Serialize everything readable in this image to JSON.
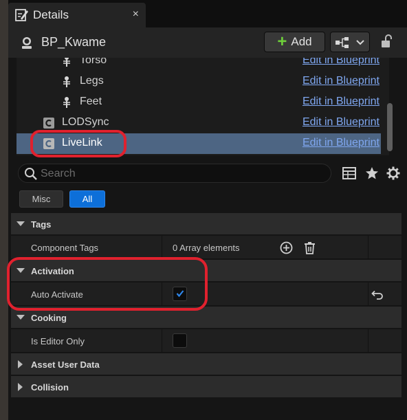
{
  "tab": {
    "title": "Details",
    "close": "×"
  },
  "header": {
    "actor_name": "BP_Kwame",
    "add_label": "Add"
  },
  "components": [
    {
      "name": "Torso",
      "action": "Edit in Blueprint",
      "icon": "bone-icon"
    },
    {
      "name": "Legs",
      "action": "Edit in Blueprint",
      "icon": "bone-icon"
    },
    {
      "name": "Feet",
      "action": "Edit in Blueprint",
      "icon": "bone-icon"
    },
    {
      "name": "LODSync",
      "action": "Edit in Blueprint",
      "icon": "component-c-icon"
    },
    {
      "name": "LiveLink",
      "action": "Edit in Blueprint",
      "icon": "component-c-icon",
      "selected": true
    }
  ],
  "search": {
    "placeholder": "Search"
  },
  "filters": {
    "misc": "Misc",
    "all": "All"
  },
  "categories": {
    "tags": "Tags",
    "activation": "Activation",
    "cooking": "Cooking",
    "asset_user_data": "Asset User Data",
    "collision": "Collision"
  },
  "properties": {
    "component_tags": {
      "label": "Component Tags",
      "value": "0 Array elements"
    },
    "auto_activate": {
      "label": "Auto Activate",
      "checked": true
    },
    "is_editor_only": {
      "label": "Is Editor Only",
      "checked": false
    }
  },
  "colors": {
    "selection": "#4d6583",
    "accent": "#0d6fd9",
    "highlight": "#e0212e",
    "link": "#7fa7f0",
    "add_plus": "#6ecf3a"
  }
}
